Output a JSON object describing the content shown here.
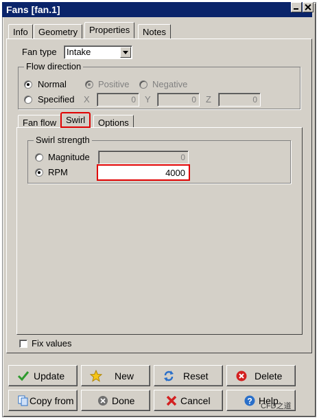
{
  "window": {
    "title": "Fans [fan.1]"
  },
  "tabs": [
    {
      "label": "Info"
    },
    {
      "label": "Geometry"
    },
    {
      "label": "Properties"
    },
    {
      "label": "Notes"
    }
  ],
  "fan_type": {
    "label": "Fan type",
    "value": "Intake"
  },
  "flow_direction": {
    "label": "Flow direction",
    "normal": "Normal",
    "positive": "Positive",
    "negative": "Negative",
    "specified": "Specified",
    "x_label": "X",
    "x_value": "0",
    "y_label": "Y",
    "y_value": "0",
    "z_label": "Z",
    "z_value": "0"
  },
  "subtabs": [
    {
      "label": "Fan flow"
    },
    {
      "label": "Swirl"
    },
    {
      "label": "Options"
    }
  ],
  "swirl": {
    "group_label": "Swirl strength",
    "magnitude_label": "Magnitude",
    "magnitude_value": "0",
    "rpm_label": "RPM",
    "rpm_value": "4000"
  },
  "fix_values": {
    "label": "Fix values"
  },
  "buttons": {
    "update": "Update",
    "new": "New",
    "reset": "Reset",
    "delete": "Delete",
    "copy_from": "Copy from",
    "done": "Done",
    "cancel": "Cancel",
    "help": "Help"
  },
  "watermark": "CFD之道"
}
